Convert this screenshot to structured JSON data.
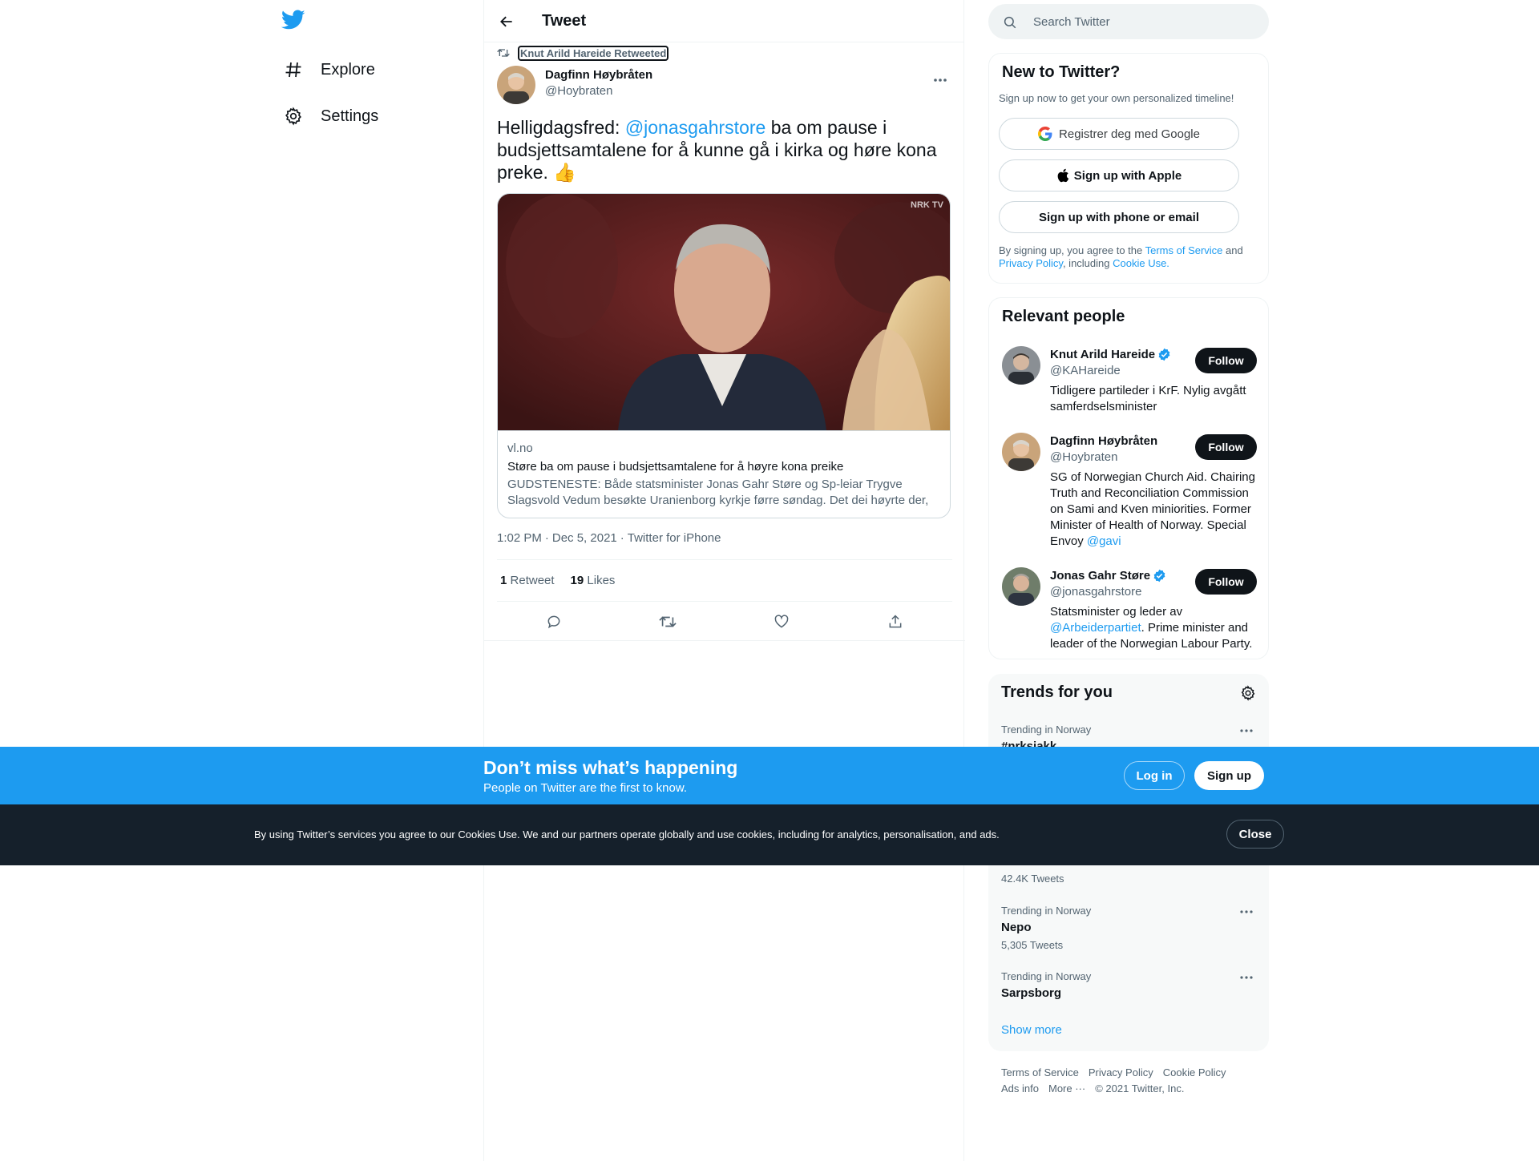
{
  "nav": {
    "items": [
      {
        "label": "Explore",
        "icon": "hashtag-icon"
      },
      {
        "label": "Settings",
        "icon": "gear-icon"
      }
    ]
  },
  "header": {
    "title": "Tweet"
  },
  "tweet": {
    "retweeted_by": "Knut Arild Hareide Retweeted",
    "author_name": "Dagfinn Høybråten",
    "author_handle": "@Hoybraten",
    "text_before": "Helligdagsfred: ",
    "mention": "@jonasgahrstore",
    "text_after": " ba om pause i budsjettsamtalene for å kunne gå i kirka og høre kona preke. ",
    "emoji": "👍",
    "card": {
      "watermark": "NRK TV",
      "domain": "vl.no",
      "title": "Støre ba om pause i budsjettsamtalene for å høyre kona preike",
      "description": "GUDSTENESTE: Både statsminister Jonas Gahr Støre og Sp-leiar Trygve Slagsvold Vedum besøkte Uranienborg kyrkje førre søndag. Det dei høyrte der, …"
    },
    "time": "1:02 PM",
    "date": "Dec 5, 2021",
    "source": "Twitter for iPhone",
    "retweets_count": "1",
    "retweets_label": "Retweet",
    "likes_count": "19",
    "likes_label": "Likes"
  },
  "search": {
    "placeholder": "Search Twitter"
  },
  "new_to_twitter": {
    "title": "New to Twitter?",
    "subtitle": "Sign up now to get your own personalized timeline!",
    "google": "Registrer deg med Google",
    "apple": "Sign up with Apple",
    "phone": "Sign up with phone or email",
    "legal_1": "By signing up, you agree to the ",
    "tos": "Terms of Service",
    "legal_2": " and ",
    "privacy": "Privacy Policy",
    "legal_3": ", including ",
    "cookie": "Cookie Use."
  },
  "relevant": {
    "title": "Relevant people",
    "follow_label": "Follow",
    "people": [
      {
        "name": "Knut Arild Hareide",
        "handle": "@KAHareide",
        "verified": true,
        "bio": "Tidligere partileder i KrF. Nylig avgått samferdselsminister"
      },
      {
        "name": "Dagfinn Høybråten",
        "handle": "@Hoybraten",
        "verified": false,
        "bio": "SG of Norwegian Church Aid. Chairing Truth and Reconciliation Commission on Sami and Kven miniorities. Former Minister of Health of Norway. Special Envoy ",
        "bio_link": "@gavi"
      },
      {
        "name": "Jonas Gahr Støre",
        "handle": "@jonasgahrstore",
        "verified": true,
        "bio_pre": "Statsminister og leder av ",
        "bio_link": "@Arbeiderpartiet",
        "bio_post": ". Prime minister and leader of the Norwegian Labour Party."
      }
    ]
  },
  "trends": {
    "title": "Trends for you",
    "items": [
      {
        "context": "Trending in Norway",
        "name": "#nrksjakk",
        "count": ""
      },
      {
        "context": "",
        "name": "",
        "count": "42.4K Tweets"
      },
      {
        "context": "Trending in Norway",
        "name": "Nepo",
        "count": "5,305 Tweets"
      },
      {
        "context": "Trending in Norway",
        "name": "Sarpsborg",
        "count": ""
      }
    ],
    "show_more": "Show more"
  },
  "footer": {
    "links": [
      "Terms of Service",
      "Privacy Policy",
      "Cookie Policy",
      "Ads info",
      "More ···",
      "© 2021 Twitter, Inc."
    ]
  },
  "banner": {
    "headline": "Don’t miss what’s happening",
    "sub": "People on Twitter are the first to know.",
    "login": "Log in",
    "signup": "Sign up"
  },
  "cookie_bar": {
    "text": "By using Twitter’s services you agree to our Cookies Use. We and our partners operate globally and use cookies, including for analytics, personalisation, and ads.",
    "close": "Close"
  },
  "colors": {
    "accent": "#1d9bf0",
    "text": "#0f1419",
    "muted": "#536471",
    "cookie_bg": "#15202b"
  }
}
